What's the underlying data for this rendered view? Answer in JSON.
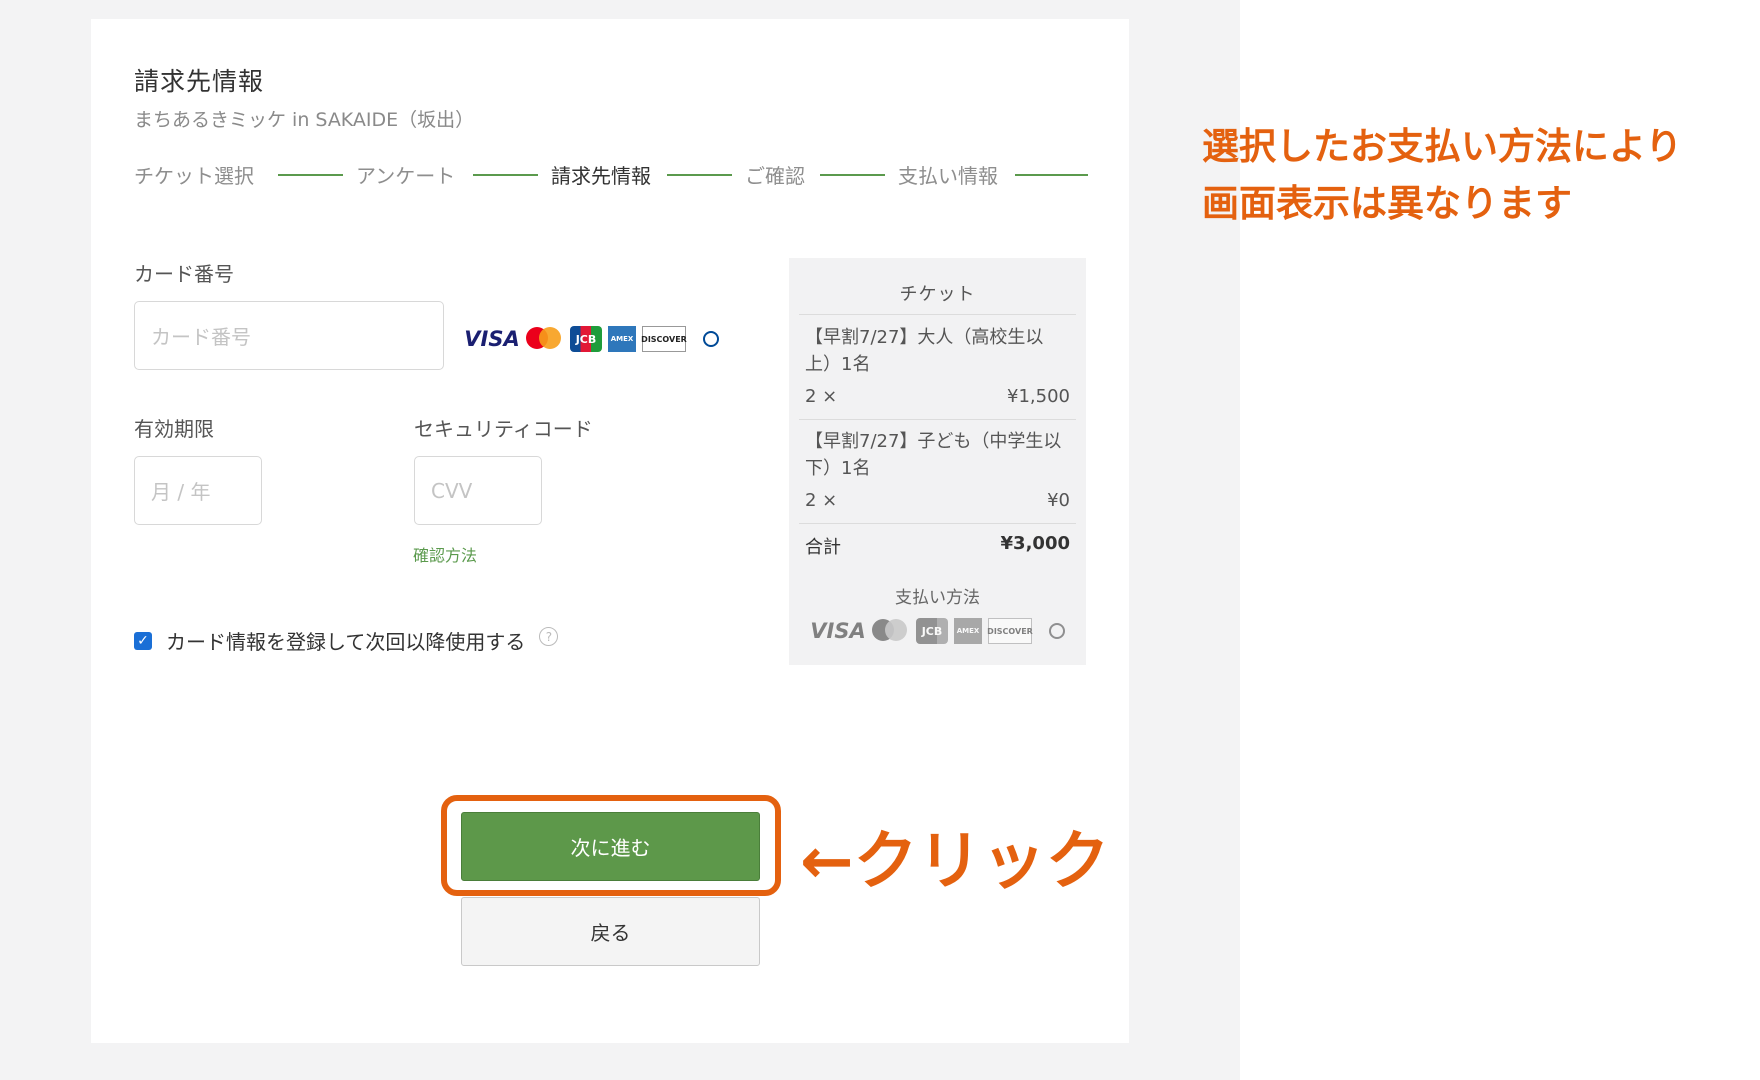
{
  "colors": {
    "accent_green": "#5d984a",
    "annotation_orange": "#e4610f"
  },
  "page": {
    "title": "請求先情報",
    "subtitle": "まちあるきミッケ in SAKAIDE（坂出）"
  },
  "steps": [
    {
      "label": "チケット選択",
      "active": false
    },
    {
      "label": "アンケート",
      "active": false
    },
    {
      "label": "請求先情報",
      "active": true
    },
    {
      "label": "ご確認",
      "active": false
    },
    {
      "label": "支払い情報",
      "active": false
    }
  ],
  "form": {
    "card_number_label": "カード番号",
    "card_number_placeholder": "カード番号",
    "expiry_label": "有効期限",
    "expiry_placeholder": "月 / 年",
    "cvc_label": "セキュリティコード",
    "cvc_placeholder": "CVV",
    "cvc_help_link": "確認方法",
    "save_card_label": "カード情報を登録して次回以降使用する",
    "save_card_checked": true
  },
  "brands": {
    "visa": "VISA",
    "mastercard": "mastercard",
    "jcb": "JCB",
    "amex": "AMERICAN EXPRESS",
    "discover": "DISCOVER",
    "diners": "Diners Club"
  },
  "summary": {
    "title": "チケット",
    "items": [
      {
        "name": "【早割7/27】大人（高校生以上）1名",
        "qty": "2 ×",
        "price": "¥1,500"
      },
      {
        "name": "【早割7/27】子ども（中学生以下）1名",
        "qty": "2 ×",
        "price": "¥0"
      }
    ],
    "total_label": "合計",
    "total_price": "¥3,000",
    "payment_method_label": "支払い方法"
  },
  "buttons": {
    "next": "次に進む",
    "back": "戻る"
  },
  "annotations": {
    "click": "←クリック",
    "note_line1": "選択したお支払い方法により",
    "note_line2": "画面表示は異なります"
  }
}
